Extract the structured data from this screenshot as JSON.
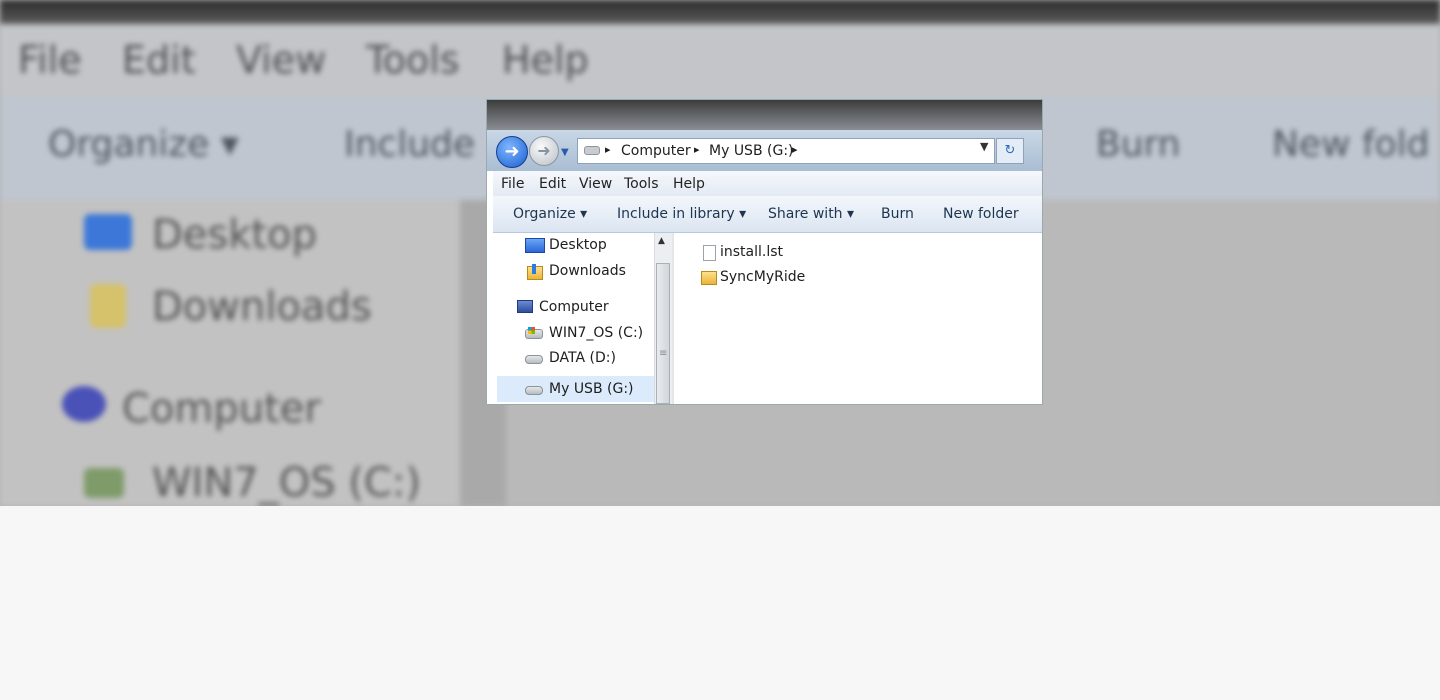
{
  "background": {
    "menu": [
      "File",
      "Edit",
      "View",
      "Tools",
      "Help"
    ],
    "toolbar": [
      "Organize ▾",
      "Include",
      "Burn",
      "New fold"
    ],
    "nav": [
      "Desktop",
      "Downloads",
      "Computer",
      "WIN7_OS (C:)"
    ]
  },
  "window": {
    "address": {
      "crumbs": [
        "Computer",
        "My USB (G:)"
      ],
      "separator": "▸",
      "back_icon": "back-arrow-icon",
      "forward_icon": "forward-arrow-icon"
    },
    "menu": [
      "File",
      "Edit",
      "View",
      "Tools",
      "Help"
    ],
    "commands": [
      "Organize ▾",
      "Include in library ▾",
      "Share with ▾",
      "Burn",
      "New folder"
    ],
    "nav": {
      "items": [
        {
          "label": "Desktop",
          "icon": "desktop-icon"
        },
        {
          "label": "Downloads",
          "icon": "downloads-folder-icon"
        },
        {
          "label": "Computer",
          "icon": "computer-icon"
        },
        {
          "label": "WIN7_OS (C:)",
          "icon": "os-drive-icon"
        },
        {
          "label": "DATA (D:)",
          "icon": "drive-icon"
        },
        {
          "label": "My USB (G:)",
          "icon": "usb-drive-icon"
        }
      ],
      "selected": "My USB (G:)"
    },
    "files": [
      {
        "name": "install.lst",
        "icon": "file-icon"
      },
      {
        "name": "SyncMyRide",
        "icon": "folder-icon"
      }
    ]
  },
  "colors": {
    "selection": "#dcebfc",
    "command_text": "#1e3552",
    "backdrop": "#f7f7f7"
  }
}
